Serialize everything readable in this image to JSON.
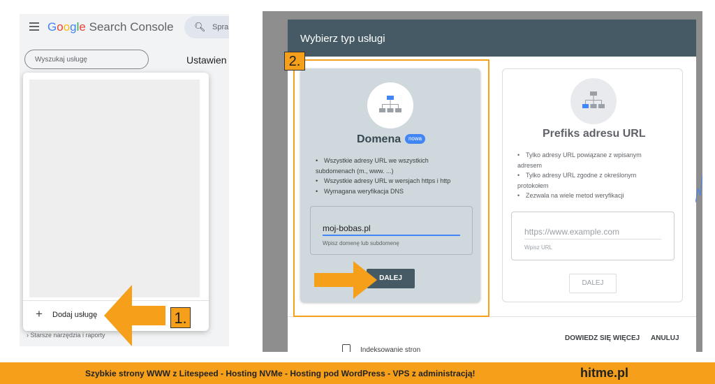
{
  "left_panel": {
    "app_name": "Search Console",
    "logo_letters": [
      "G",
      "o",
      "o",
      "g",
      "l",
      "e"
    ],
    "top_search": {
      "icon": "search-icon",
      "text": "Spra"
    },
    "property_search": {
      "placeholder": "Wyszukaj usługę"
    },
    "settings_title": "Ustawien",
    "add_property": {
      "icon": "plus-icon",
      "label": "Dodaj usługę"
    },
    "older_tools": "›  Starsze narzędzia i raporty",
    "step_label": "1."
  },
  "modal": {
    "title": "Wybierz typ usługi",
    "domain_card": {
      "icon": "domain-sitemap-icon",
      "title": "Domena",
      "badge": "nowa",
      "bullets": [
        "Wszystkie adresy URL we wszystkich",
        "subdomenach (m., www. ...)",
        "Wszystkie adresy URL w wersjach https i http",
        "Wymagana weryfikacja DNS"
      ],
      "input_value": "moj-bobas.pl",
      "input_hint": "Wpisz domenę lub subdomenę",
      "button": "DALEJ"
    },
    "url_card": {
      "icon": "url-prefix-sitemap-icon",
      "title": "Prefiks adresu URL",
      "bullets": [
        "Tylko adresy URL powiązane z wpisanym",
        "adresem",
        "Tylko adresy URL zgodne z określonym",
        "protokołem",
        "Zezwala na wiele metod weryfikacji"
      ],
      "input_placeholder": "https://www.example.com",
      "input_hint": "Wpisz URL",
      "button": "DALEJ"
    },
    "footer": {
      "learn_more": "DOWIEDZ SIĘ WIĘCEJ",
      "cancel": "ANULUJ"
    },
    "step_label": "2."
  },
  "background": {
    "behind_item": "Indeksowanie stron",
    "partial_text": "ub"
  },
  "banner": {
    "text": "Szybkie strony WWW z Litespeed - Hosting  NVMe - Hosting pod WordPress - VPS z administracją!",
    "brand": "hitme.pl"
  },
  "colors": {
    "accent_orange": "#f59f1a",
    "modal_header": "#455a64",
    "badge_blue": "#4285f4",
    "domain_card_bg": "#cfd8dc"
  }
}
